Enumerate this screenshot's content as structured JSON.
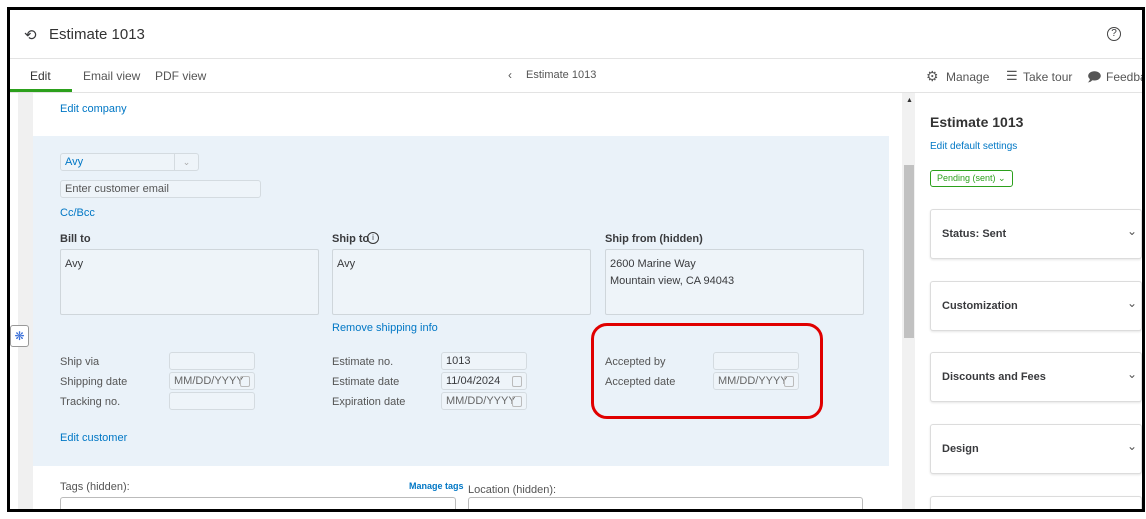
{
  "header": {
    "title": "Estimate 1013",
    "help_icon": "question-circle-icon"
  },
  "tabs": [
    {
      "label": "Edit",
      "active": true
    },
    {
      "label": "Email view"
    },
    {
      "label": "PDF view"
    }
  ],
  "nav": {
    "prev_label": "Estimate 1013",
    "manage": "Manage",
    "tour": "Take tour",
    "feedback": "Feedba"
  },
  "form": {
    "edit_company": "Edit company",
    "customer": "Avy",
    "email_placeholder": "Enter customer email",
    "ccbcc": "Cc/Bcc",
    "bill_to_label": "Bill to",
    "bill_to": "Avy",
    "ship_to_label": "Ship to",
    "ship_to": "Avy",
    "ship_from_label": "Ship from (hidden)",
    "ship_from_line1": "2600 Marine Way",
    "ship_from_line2": "Mountain view, CA 94043",
    "remove_shipping": "Remove shipping info",
    "ship_via": "Ship via",
    "shipping_date": "Shipping date",
    "tracking_no": "Tracking no.",
    "date_placeholder": "MM/DD/YYYY",
    "estimate_no_label": "Estimate no.",
    "estimate_no": "1013",
    "estimate_date_label": "Estimate date",
    "estimate_date": "11/04/2024",
    "expiration_label": "Expiration date",
    "accepted_by": "Accepted by",
    "accepted_date": "Accepted date",
    "edit_customer": "Edit customer",
    "tags_label": "Tags (hidden):",
    "manage_tags": "Manage tags",
    "location_label": "Location (hidden):"
  },
  "sidebar": {
    "title": "Estimate 1013",
    "edit_defaults": "Edit default settings",
    "status_badge": "Pending (sent)",
    "sections": [
      "Status: Sent",
      "Customization",
      "Discounts and Fees",
      "Design"
    ]
  },
  "colors": {
    "accent": "#0077c5",
    "green": "#2ca01c",
    "highlight": "#e00000",
    "panel": "#eaf2f9"
  }
}
